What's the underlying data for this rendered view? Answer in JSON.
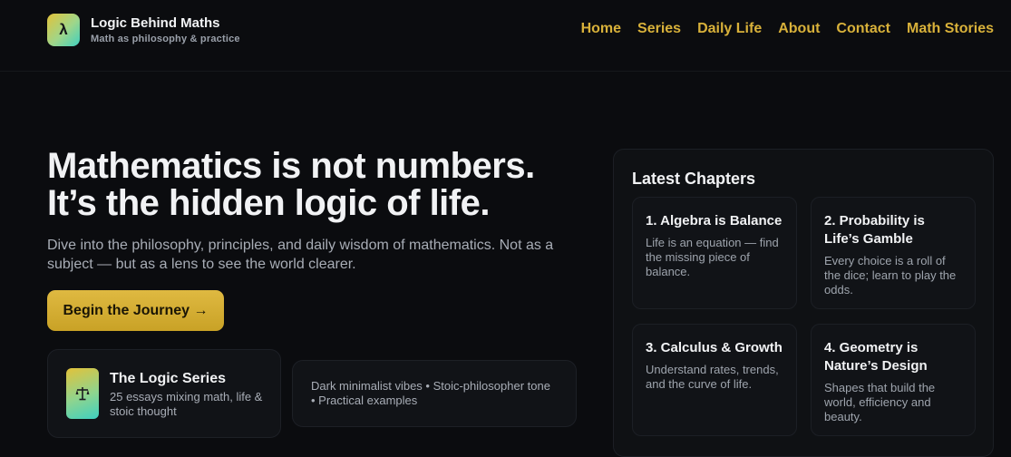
{
  "brand": {
    "logo_glyph": "λ",
    "title": "Logic Behind Maths",
    "tagline": "Math as philosophy & practice"
  },
  "nav": {
    "items": [
      "Home",
      "Series",
      "Daily Life",
      "About",
      "Contact",
      "Math Stories"
    ]
  },
  "hero": {
    "title_line1": "Mathematics is not numbers.",
    "title_line2": "It’s the hidden logic of life.",
    "subtitle": "Dive into the philosophy, principles, and daily wisdom of mathematics. Not as a subject — but as a lens to see the world clearer.",
    "cta_label": "Begin the Journey →"
  },
  "series_card": {
    "icon": "scales-icon",
    "title": "The Logic Series",
    "description": "25 essays mixing math, life & stoic thought"
  },
  "vibe_card": {
    "text": "Dark minimalist vibes • Stoic-philosopher tone • Practical examples"
  },
  "latest": {
    "heading": "Latest Chapters",
    "chapters": [
      {
        "title": "1. Algebra is Balance",
        "description": "Life is an equation — find the missing piece of balance."
      },
      {
        "title": "2. Probability is Life’s Gamble",
        "description": "Every choice is a roll of the dice; learn to play the odds."
      },
      {
        "title": "3. Calculus & Growth",
        "description": "Understand rates, trends, and the curve of life."
      },
      {
        "title": "4. Geometry is Nature’s Design",
        "description": "Shapes that build the world, efficiency and beauty."
      }
    ]
  },
  "colors": {
    "background": "#0b0c0f",
    "accent": "#d8b13a",
    "card": "#111317",
    "muted_text": "#a8adb6"
  }
}
